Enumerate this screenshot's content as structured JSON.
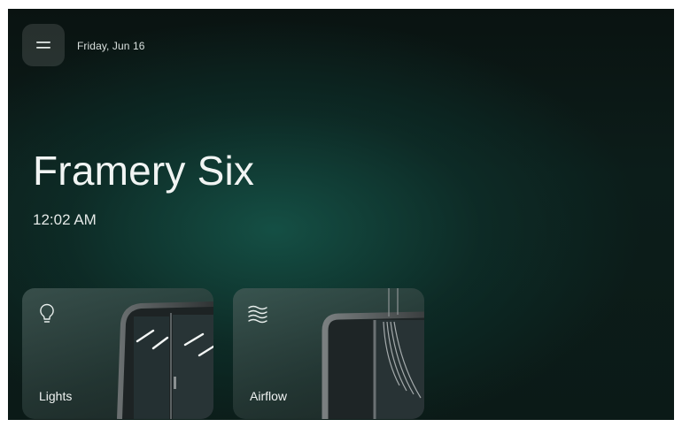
{
  "header": {
    "menu_icon": "menu-icon",
    "date": "Friday, Jun 16"
  },
  "main": {
    "title": "Framery Six",
    "time": "12:02 AM"
  },
  "cards": [
    {
      "label": "Lights",
      "icon": "lightbulb-icon"
    },
    {
      "label": "Airflow",
      "icon": "airflow-icon"
    }
  ],
  "colors": {
    "background": "#0c1d1a",
    "accent": "#16584c",
    "text": "#f1f4f3"
  }
}
